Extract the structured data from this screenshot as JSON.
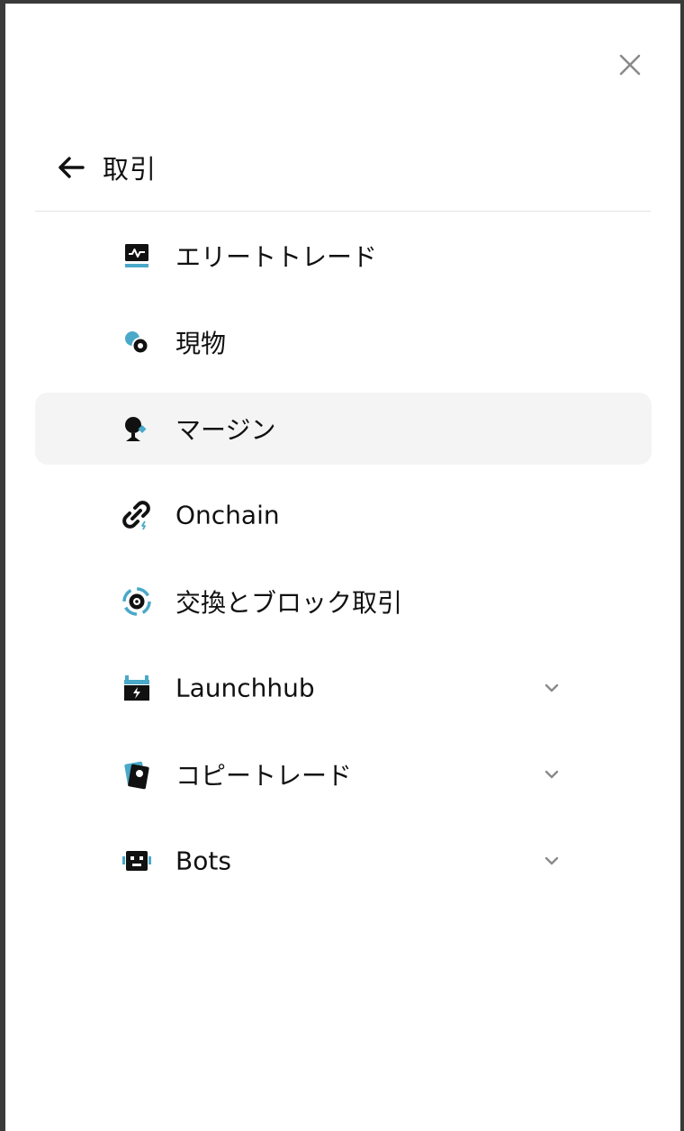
{
  "header": {
    "back_title": "取引"
  },
  "menu": {
    "items": [
      {
        "label": "エリートトレード",
        "icon": "chart-monitor-icon",
        "expandable": false,
        "active": false
      },
      {
        "label": "現物",
        "icon": "coins-icon",
        "expandable": false,
        "active": false
      },
      {
        "label": "マージン",
        "icon": "margin-icon",
        "expandable": false,
        "active": true
      },
      {
        "label": "Onchain",
        "icon": "chain-link-icon",
        "expandable": false,
        "active": false
      },
      {
        "label": "交換とブロック取引",
        "icon": "target-swap-icon",
        "expandable": false,
        "active": false
      },
      {
        "label": "Launchhub",
        "icon": "calendar-bolt-icon",
        "expandable": true,
        "active": false
      },
      {
        "label": "コピートレード",
        "icon": "copy-cards-icon",
        "expandable": true,
        "active": false
      },
      {
        "label": "Bots",
        "icon": "robot-icon",
        "expandable": true,
        "active": false
      }
    ]
  },
  "colors": {
    "accent": "#4aa8c9",
    "text": "#111111",
    "active_bg": "#f4f4f5",
    "divider": "#e3e3e3"
  }
}
